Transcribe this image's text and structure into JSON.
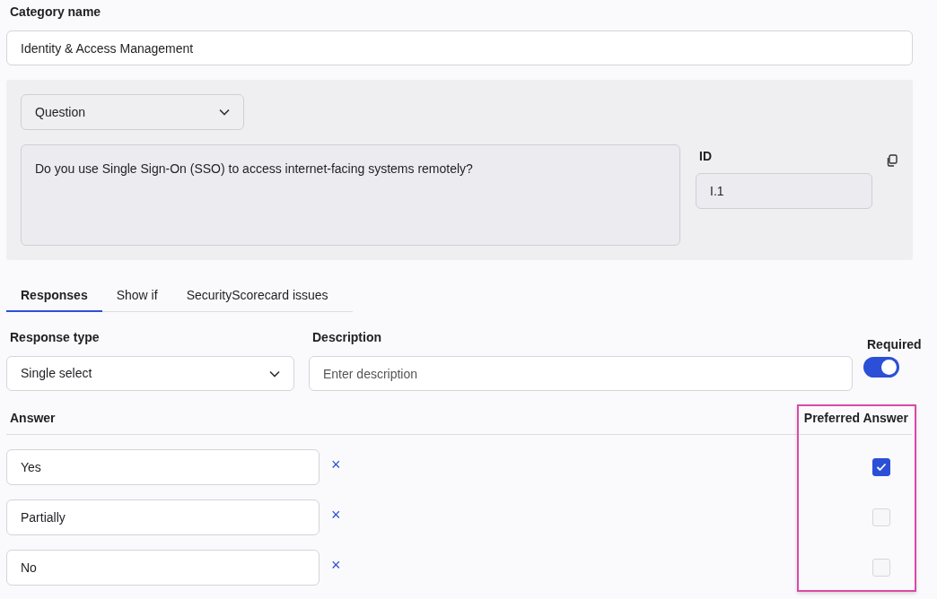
{
  "category": {
    "label": "Category name",
    "value": "Identity & Access Management"
  },
  "question": {
    "type": "Question",
    "text": "Do you use Single Sign-On (SSO) to access internet-facing systems remotely?",
    "id_label": "ID",
    "id_value": "I.1"
  },
  "tabs": [
    {
      "label": "Responses",
      "selected": true
    },
    {
      "label": "Show if",
      "selected": false
    },
    {
      "label": "SecurityScorecard issues",
      "selected": false
    }
  ],
  "response_type": {
    "label": "Response type",
    "value": "Single select"
  },
  "description": {
    "label": "Description",
    "placeholder": "Enter description"
  },
  "required": {
    "label": "Required",
    "on": true
  },
  "answers": {
    "label": "Answer",
    "preferred_label": "Preferred Answer",
    "highlighted": true,
    "rows": [
      {
        "value": "Yes",
        "remove": "×",
        "preferred": true
      },
      {
        "value": "Partially",
        "remove": "×",
        "preferred": false
      },
      {
        "value": "No",
        "remove": "×",
        "preferred": false
      }
    ]
  }
}
